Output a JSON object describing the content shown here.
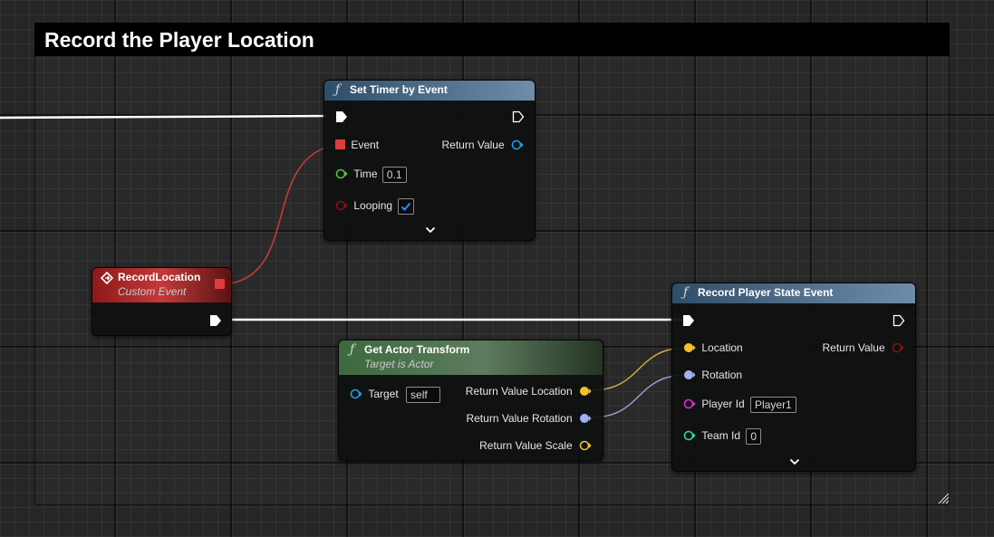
{
  "comment": {
    "title": "Record the Player Location"
  },
  "nodes": {
    "set_timer": {
      "title": "Set Timer by Event",
      "pins": {
        "event": "Event",
        "return_value": "Return Value",
        "time": "Time",
        "time_value": "0.1",
        "looping": "Looping"
      },
      "looping_checked": true
    },
    "record_location": {
      "title": "RecordLocation",
      "subtitle": "Custom Event"
    },
    "get_actor_transform": {
      "title": "Get Actor Transform",
      "subtitle": "Target is Actor",
      "pins": {
        "target": "Target",
        "target_value": "self",
        "return_location": "Return Value Location",
        "return_rotation": "Return Value Rotation",
        "return_scale": "Return Value Scale"
      }
    },
    "record_player_state": {
      "title": "Record Player State Event",
      "pins": {
        "location": "Location",
        "return_value": "Return Value",
        "rotation": "Rotation",
        "player_id": "Player Id",
        "player_id_value": "Player1",
        "team_id": "Team Id",
        "team_id_value": "0"
      }
    }
  },
  "colors": {
    "exec": "#ffffff",
    "delegate": "#e23b3b",
    "float": "#4fc83a",
    "bool": "#8a0f0f",
    "vector": "#f5c02a",
    "rotator": "#9fb0f5",
    "string": "#e22ad9",
    "int": "#2ad6b0",
    "object": "#1d9bf0"
  },
  "icons": [
    "function-icon",
    "custom-event-icon",
    "exec-pin-icon",
    "expand-chevron-icon",
    "resize-handle-icon",
    "checkmark-icon"
  ]
}
